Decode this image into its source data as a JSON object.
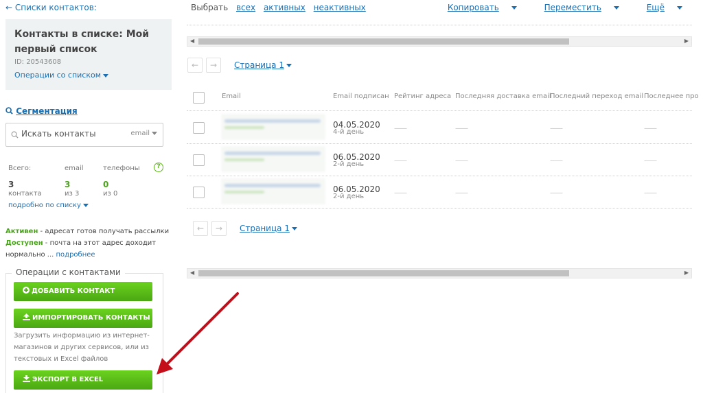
{
  "sidebar": {
    "back_link": "← Списки контактов:",
    "list_title": "Контакты в списке: Мой первый список",
    "list_id": "ID: 20543608",
    "list_operations": "Операции со списком",
    "segmentation": "Сегментация",
    "search": {
      "placeholder": "Искать контакты",
      "type": "email"
    },
    "stats": {
      "headers": [
        "Всего:",
        "email",
        "телефоны"
      ],
      "values": [
        "3",
        "3",
        "0"
      ],
      "subs": [
        "контакта",
        "из 3",
        "из 0"
      ]
    },
    "details_link": "подробно по списку",
    "legend": {
      "active_label": "Активен",
      "active_text": " - адресат готов получать рассылки",
      "available_label": "Доступен",
      "available_text": " - почта на этот адрес доходит нормально ... ",
      "more_link": "подробнее"
    },
    "contact_operations": {
      "title": "Операции с контактами",
      "add_button": "ДОБАВИТЬ КОНТАКТ",
      "import_button": "ИМПОРТИРОВАТЬ КОНТАКТЫ",
      "import_description": "Загрузить информацию из интернет-магазинов и других сервисов, или из текстовых и Excel файлов",
      "export_button": "ЭКСПОРТ В EXCEL"
    }
  },
  "toolbar": {
    "select_label": "Выбрать",
    "select_all": "всех",
    "select_active": "активных",
    "select_inactive": "неактивных",
    "copy": "Копировать",
    "move": "Переместить",
    "more": "Ещё"
  },
  "pagination": {
    "label": "Страница 1"
  },
  "table": {
    "columns": [
      "Email",
      "Email подписан",
      "Рейтинг адреса",
      "Последняя доставка email",
      "Последний переход email",
      "Последнее про"
    ],
    "rows": [
      {
        "date": "04.05.2020",
        "day": "4-й день"
      },
      {
        "date": "06.05.2020",
        "day": "2-й день"
      },
      {
        "date": "06.05.2020",
        "day": "2-й день"
      }
    ],
    "empty": "——"
  },
  "colors": {
    "accent": "#1a6fb3",
    "green": "#4aa812"
  }
}
